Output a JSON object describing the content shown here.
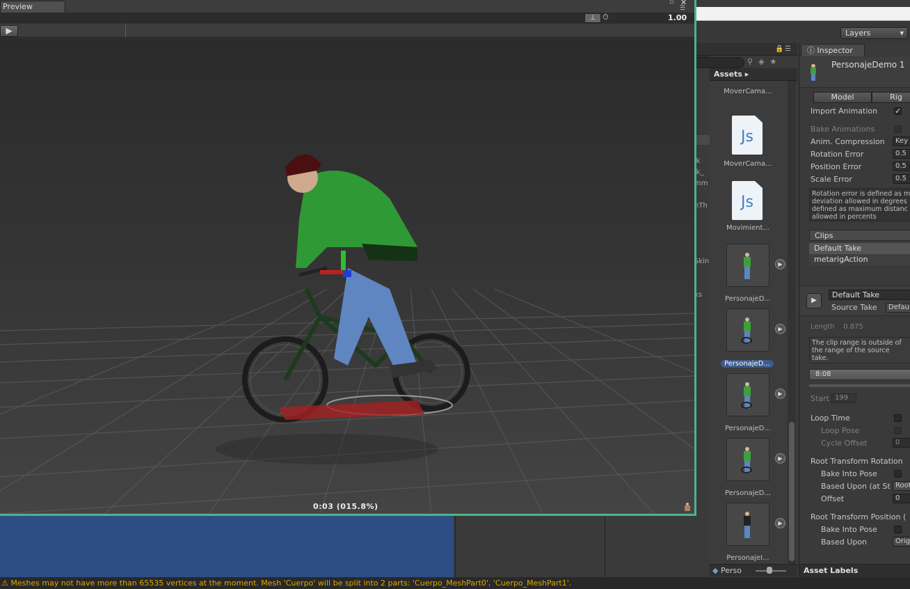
{
  "preview": {
    "tab_label": "Preview",
    "speed_value": "1.00",
    "time_label": "0:03 (015.8%)"
  },
  "layers_dropdown": "Layers",
  "hierarchy_fragments": [
    "ık",
    "ık_",
    "mm",
    "nTh",
    "Skin",
    "ks"
  ],
  "project": {
    "breadcrumb": "Assets ▸",
    "assets": [
      {
        "label": "MoverCama...",
        "kind": "script",
        "icon_text": "Js"
      },
      {
        "label": "MoverCama...",
        "kind": "script",
        "icon_text": "Js"
      },
      {
        "label": "Movimient...",
        "kind": "script",
        "icon_text": "Js"
      },
      {
        "label": "PersonajeD...",
        "kind": "model"
      },
      {
        "label": "PersonajeD...",
        "kind": "model",
        "selected": true
      },
      {
        "label": "PersonajeD...",
        "kind": "model"
      },
      {
        "label": "PersonajeD...",
        "kind": "model"
      },
      {
        "label": "PersonajeI...",
        "kind": "model"
      }
    ],
    "footer_label": "Perso"
  },
  "inspector": {
    "tab_label": "Inspector",
    "object_name": "PersonajeDemo 1",
    "tabs": [
      "Model",
      "Rig"
    ],
    "import_animation": "Import Animation",
    "bake_animations": "Bake Animations",
    "anim_compression": "Anim. Compression",
    "anim_compression_value": "Key",
    "rotation_error": "Rotation Error",
    "rotation_error_value": "0.5",
    "position_error": "Position Error",
    "position_error_value": "0.5",
    "scale_error": "Scale Error",
    "scale_error_value": "0.5",
    "help_text": [
      "Rotation error is defined as m",
      "deviation allowed in degrees",
      "defined as maximum distanc",
      "allowed in percents"
    ],
    "clips_header": "Clips",
    "clips": [
      "Default Take",
      "metarigAction"
    ],
    "clip_name": "Default Take",
    "source_take": "Source Take",
    "source_take_value": "Defau",
    "length_label": "Length",
    "length_value": "0.875",
    "range_help": [
      "The clip range is outside of",
      "the range of the source",
      "take."
    ],
    "timeline_value": "8:08",
    "start_label": "Start",
    "start_value": "199",
    "loop_time": "Loop Time",
    "loop_pose": "Loop Pose",
    "cycle_offset": "Cycle Offset",
    "cycle_offset_value": "0",
    "root_rot": "Root Transform Rotation",
    "bake_into_pose_1": "Bake Into Pose",
    "based_upon_1": "Based Upon (at St",
    "based_upon_1_value": "Root",
    "offset": "Offset",
    "offset_value": "0",
    "root_pos": "Root Transform Position (",
    "bake_into_pose_2": "Bake Into Pose",
    "based_upon_2": "Based Upon",
    "based_upon_2_value": "Origi",
    "asset_labels": "Asset Labels"
  },
  "status_message": "Meshes may not have more than 65535 vertices at the moment. Mesh 'Cuerpo' will be split into 2 parts: 'Cuerpo_MeshPart0', 'Cuerpo_MeshPart1'.",
  "colors": {
    "preview_border": "#4db38a",
    "status_text": "#e0a800",
    "selection": "#3d5a8a",
    "scrubber": "#c43030"
  }
}
